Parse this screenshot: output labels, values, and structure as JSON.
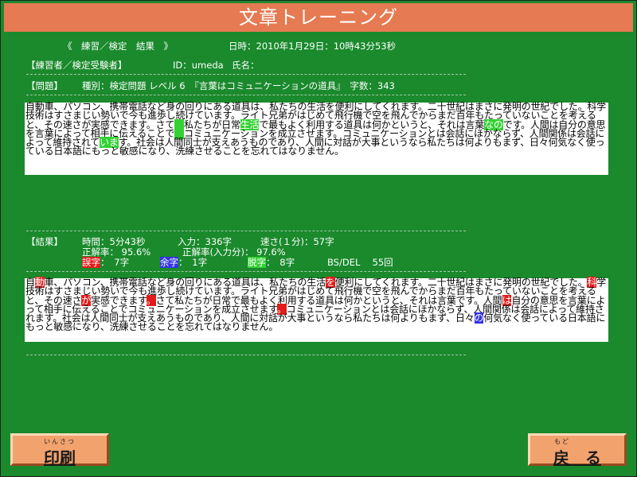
{
  "title": "文章トレーニング",
  "header": {
    "result_title": "《　練習／検定　結果　》",
    "datetime": "日時：2010年1月29日：10時43分53秒"
  },
  "candidate": {
    "label": "【練習者／検定受験者】",
    "id_text": "ID：umeda",
    "name_label": "氏名："
  },
  "problem": {
    "label": "【問題】",
    "info": "種別：検定問題 レベル 6　『言葉はコミュニケーションの道具』　字数：343"
  },
  "problem_text": [
    {
      "t": "自動車、パソコン、携帯電話など身の回りにある道具は、私たちの生活を便利にしてくれます。二十世紀はまさに発明の世紀でした。科学技術はすさまじい勢いで今も進歩し続けています。ライト兄弟がはじめて飛行機で空を飛んでからまだ百年もたっていないことを考えると、その速さが実感できます。さて",
      "c": ""
    },
    {
      "t": "　",
      "c": "green"
    },
    {
      "t": "私たちが日常",
      "c": ""
    },
    {
      "t": "生活",
      "c": "green"
    },
    {
      "t": "で最もよく利用する道具は何かというと、それは言葉",
      "c": ""
    },
    {
      "t": "なの",
      "c": "green"
    },
    {
      "t": "です。人間は自分の意思を言葉によって相手に伝えることで",
      "c": ""
    },
    {
      "t": "　",
      "c": "green"
    },
    {
      "t": "コミュニケーションを成立させます。コミュニケーションとは会話にほかならず、人間関係は会話によって維持されて",
      "c": ""
    },
    {
      "t": "いま",
      "c": "green"
    },
    {
      "t": "す。社会は人間同士が支えあうものであり、人間に対話が大事というなら私たちは何よりもまず、日々何気なく使っている日本語にもっと敏感になり、洗練させることを忘れてはなりません。",
      "c": ""
    }
  ],
  "result": {
    "label": "【結果】",
    "time": "時間：5分43秒",
    "input": "入力：336字",
    "speed": "速さ(１分)：57字",
    "accuracy": "正解率： 95.6%",
    "accuracy_input": "正解率(入力分)： 97.6%",
    "wrong_label": "誤字",
    "wrong_value": "：　7字",
    "extra_label": "余字",
    "extra_value": "：　1字",
    "missing_label": "脱字",
    "missing_value": "：　8字",
    "bsdel": "BS/DEL　 55回"
  },
  "typed_text": [
    {
      "t": "自",
      "c": ""
    },
    {
      "t": "動",
      "c": "red"
    },
    {
      "t": "車、パソコン、携帯電話など身の回りにある道具は、私たちの生活",
      "c": ""
    },
    {
      "t": "を",
      "c": "red"
    },
    {
      "t": "便利にしてくれます。二十世紀はまさに発明の世紀でした。",
      "c": ""
    },
    {
      "t": "科",
      "c": "red"
    },
    {
      "t": "学技術はすさまじい勢いで今も進歩し続けています。ライト兄弟がはじめて飛行機で空を飛んでからまだ百年もたっていないことを考えると、その速さ",
      "c": ""
    },
    {
      "t": "が",
      "c": "red"
    },
    {
      "t": "実感できます",
      "c": ""
    },
    {
      "t": "。",
      "c": "red"
    },
    {
      "t": "さて私たちが日常で最もよく利用する道具は何かというと、それは言葉です。人間",
      "c": ""
    },
    {
      "t": "は",
      "c": "red"
    },
    {
      "t": "自分の意思を言葉によって相手に伝えることでコミュニケーションを成立させます",
      "c": ""
    },
    {
      "t": "。",
      "c": "red"
    },
    {
      "t": "コミュニケーションとは会話にほかならず、人間関係は会話によって維持されます。社会は人間同士が支えあうものであり、人間に対話が大事というなら私たちは何よりもまず、日々",
      "c": ""
    },
    {
      "t": "の",
      "c": "blue"
    },
    {
      "t": "何気なく使っている日本語にもっと敏感になり、洗練させることを忘れてはなりません。",
      "c": ""
    }
  ],
  "buttons": {
    "print_ruby": "いんさつ",
    "print_label": "印刷",
    "back_ruby": "もど",
    "back_label": "戻　る"
  },
  "colors": {
    "background": "#1a8a2c",
    "title_bar": "#e67a52",
    "button": "#f2a36d",
    "mark_green": "#33d133",
    "mark_red": "#e41b1b",
    "mark_blue": "#3333e4"
  }
}
